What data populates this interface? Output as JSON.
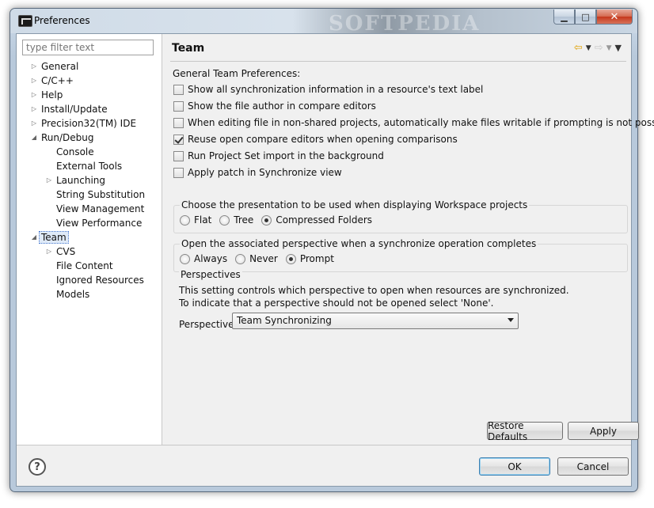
{
  "window": {
    "title": "Preferences",
    "watermark": "SOFTPEDIA",
    "minimize_glyph": "▁",
    "maximize_glyph": "□",
    "close_glyph": "✕"
  },
  "sidebar": {
    "filter_placeholder": "type filter text",
    "items": [
      {
        "label": "General",
        "twisty": "▷"
      },
      {
        "label": "C/C++",
        "twisty": "▷"
      },
      {
        "label": "Help",
        "twisty": "▷"
      },
      {
        "label": "Install/Update",
        "twisty": "▷"
      },
      {
        "label": "Precision32(TM) IDE",
        "twisty": "▷"
      },
      {
        "label": "Run/Debug",
        "twisty": "◢"
      },
      {
        "label": "Console",
        "twisty": ""
      },
      {
        "label": "External Tools",
        "twisty": ""
      },
      {
        "label": "Launching",
        "twisty": "▷"
      },
      {
        "label": "String Substitution",
        "twisty": ""
      },
      {
        "label": "View Management",
        "twisty": ""
      },
      {
        "label": "View Performance",
        "twisty": ""
      },
      {
        "label": "Team",
        "twisty": "◢"
      },
      {
        "label": "CVS",
        "twisty": "▷"
      },
      {
        "label": "File Content",
        "twisty": ""
      },
      {
        "label": "Ignored Resources",
        "twisty": ""
      },
      {
        "label": "Models",
        "twisty": ""
      }
    ]
  },
  "main": {
    "title": "Team",
    "nav": {
      "back": "⇦",
      "forward": "⇨",
      "dropdown": "▼",
      "menu": "▼"
    },
    "section_label": "General Team Preferences:",
    "checkboxes": [
      {
        "label": "Show all synchronization information in a resource's text label",
        "checked": false
      },
      {
        "label": "Show the file author in compare editors",
        "checked": false
      },
      {
        "label": "When editing file in non-shared projects, automatically make files writable if prompting is not possible",
        "checked": false
      },
      {
        "label": "Reuse open compare editors when opening comparisons",
        "checked": true
      },
      {
        "label": "Run Project Set import in the background",
        "checked": false
      },
      {
        "label": "Apply patch in Synchronize view",
        "checked": false
      }
    ],
    "presentation_group": {
      "title": "Choose the presentation to be used when displaying Workspace projects",
      "options": [
        "Flat",
        "Tree",
        "Compressed Folders"
      ],
      "selected": 2
    },
    "perspective_group": {
      "title": "Open the associated perspective when a synchronize operation completes",
      "options": [
        "Always",
        "Never",
        "Prompt"
      ],
      "selected": 2
    },
    "perspectives_group": {
      "title": "Perspectives",
      "desc1": "This setting controls which perspective to open when resources are synchronized.",
      "desc2": "To indicate that a perspective should not be opened select 'None'.",
      "label": "Perspective:",
      "value": "Team Synchronizing"
    },
    "restore_defaults": "Restore Defaults",
    "apply": "Apply"
  },
  "footer": {
    "help_glyph": "?",
    "ok": "OK",
    "cancel": "Cancel"
  }
}
